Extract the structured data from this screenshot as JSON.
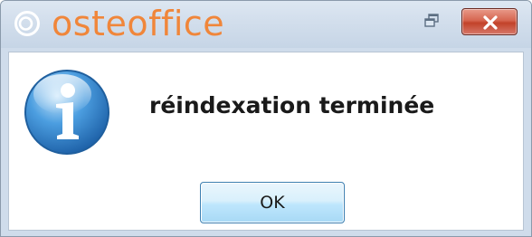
{
  "window": {
    "title": "osteoffice",
    "brand_color": "#f0863a",
    "close_button_color": "#c24229"
  },
  "titlebar": {
    "logo_icon": "osteoffice-logo-icon",
    "restore_icon": "restore-icon",
    "close_icon": "close-icon"
  },
  "dialog": {
    "icon": "info-icon",
    "message": "réindexation terminée",
    "ok_label": "OK",
    "ok_button_color": "#bee6fd"
  }
}
